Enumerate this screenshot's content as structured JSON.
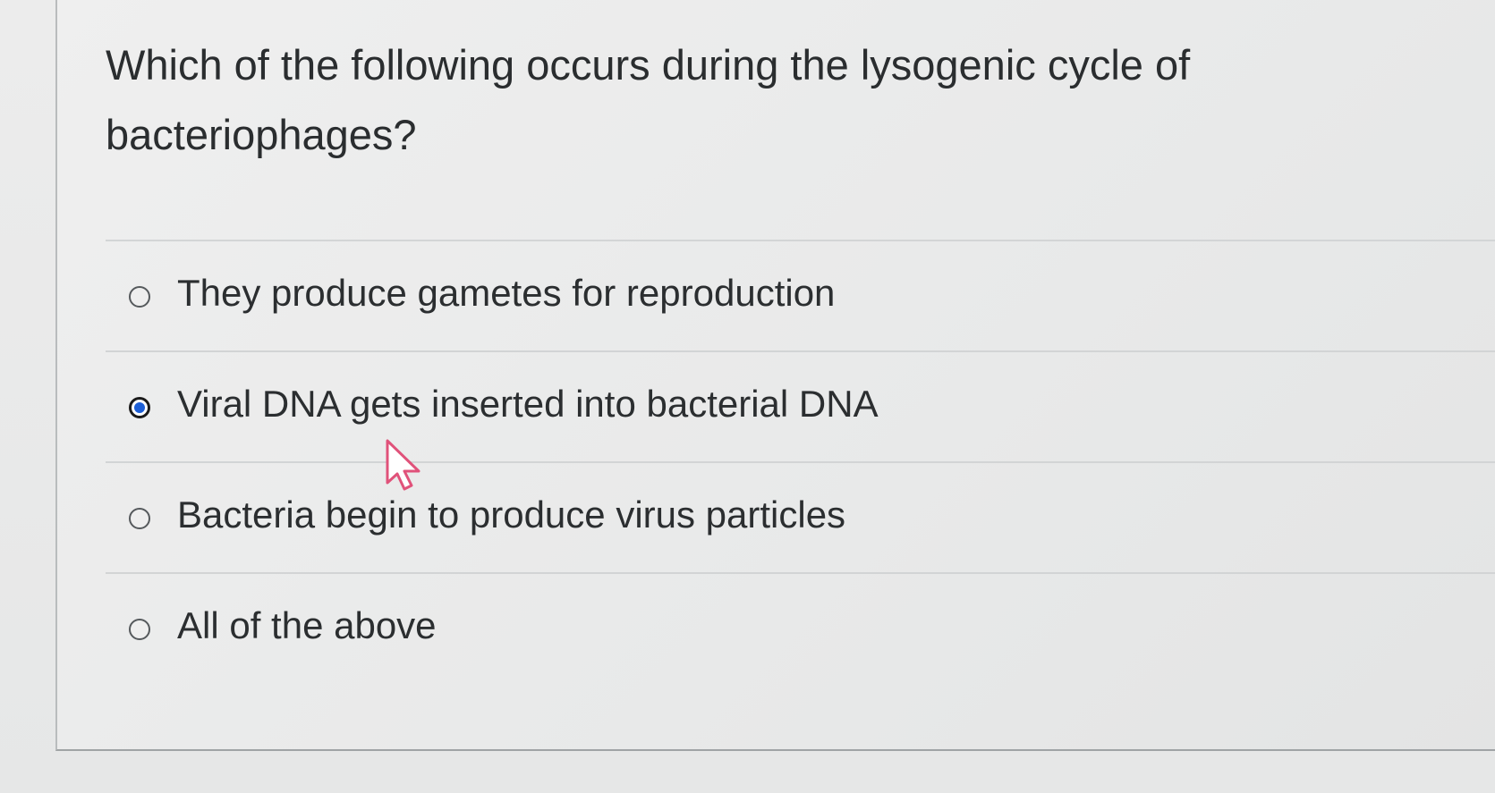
{
  "question": {
    "text": "Which of the following occurs during the lysogenic cycle of bacteriophages?"
  },
  "options": [
    {
      "label": "They produce gametes for reproduction",
      "selected": false
    },
    {
      "label": "Viral DNA gets inserted into bacterial DNA",
      "selected": true
    },
    {
      "label": "Bacteria begin to produce virus particles",
      "selected": false
    },
    {
      "label": "All of the above",
      "selected": false
    }
  ],
  "colors": {
    "selected_radio": "#1d5fd6",
    "text": "#2b2e30",
    "cursor_fill": "#ffffff",
    "cursor_outline": "#e0527a"
  },
  "icons": {
    "cursor": "mouse-pointer-icon"
  }
}
